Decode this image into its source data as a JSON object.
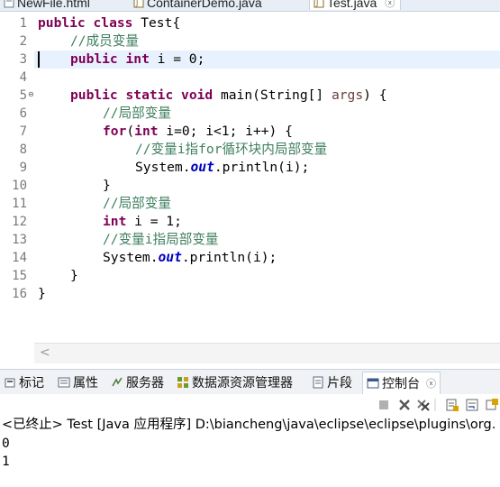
{
  "editor_tabs": [
    {
      "label": "NewFile.html"
    },
    {
      "label": "ContainerDemo.java"
    },
    {
      "label": "Test.java",
      "active": true,
      "close": "ⓧ"
    }
  ],
  "line_numbers": [
    "1",
    "2",
    "3",
    "4",
    "5",
    "6",
    "7",
    "8",
    "9",
    "10",
    "11",
    "12",
    "13",
    "14",
    "15",
    "16"
  ],
  "code": {
    "l1": {
      "kw1": "public",
      "kw2": "class",
      "rest": " Test{"
    },
    "l2": {
      "comment": "//成员变量"
    },
    "l3": {
      "kw1": "public",
      "kw2": "int",
      "rest": " i = 0;"
    },
    "l5": {
      "kw1": "public",
      "kw2": "static",
      "kw3": "void",
      "rest1": " main(String[] ",
      "param": "args",
      "rest2": ") {"
    },
    "l6": {
      "comment": "//局部变量"
    },
    "l7": {
      "kw1": "for",
      "p1": "(",
      "kw2": "int",
      "rest": " i=0; i<1; i++) {"
    },
    "l8": {
      "comment": "//变量i指for循环块内局部变量"
    },
    "l9": {
      "pre": "System.",
      "field": "out",
      "post": ".println(i);"
    },
    "l10": {
      "text": "}"
    },
    "l11": {
      "comment": "//局部变量"
    },
    "l12": {
      "kw1": "int",
      "rest": " i = 1;"
    },
    "l13": {
      "comment": "//变量i指局部变量"
    },
    "l14": {
      "pre": "System.",
      "field": "out",
      "post": ".println(i);"
    },
    "l15": {
      "text": "}"
    },
    "l16": {
      "text": "}"
    }
  },
  "fold_marker": "⊖",
  "scroll_left": "<",
  "panel_tabs": [
    {
      "label": "标记",
      "icon": "markers-icon"
    },
    {
      "label": "属性",
      "icon": "properties-icon"
    },
    {
      "label": "服务器",
      "icon": "servers-icon"
    },
    {
      "label": "数据源资源管理器",
      "icon": "datasource-icon"
    },
    {
      "label": "片段",
      "icon": "snippets-icon"
    },
    {
      "label": "控制台",
      "icon": "console-icon",
      "active": true,
      "close": "ⓧ"
    }
  ],
  "console": {
    "header": "<已终止> Test [Java 应用程序] D:\\biancheng\\java\\eclipse\\eclipse\\plugins\\org.",
    "output": [
      "0",
      "1"
    ]
  }
}
